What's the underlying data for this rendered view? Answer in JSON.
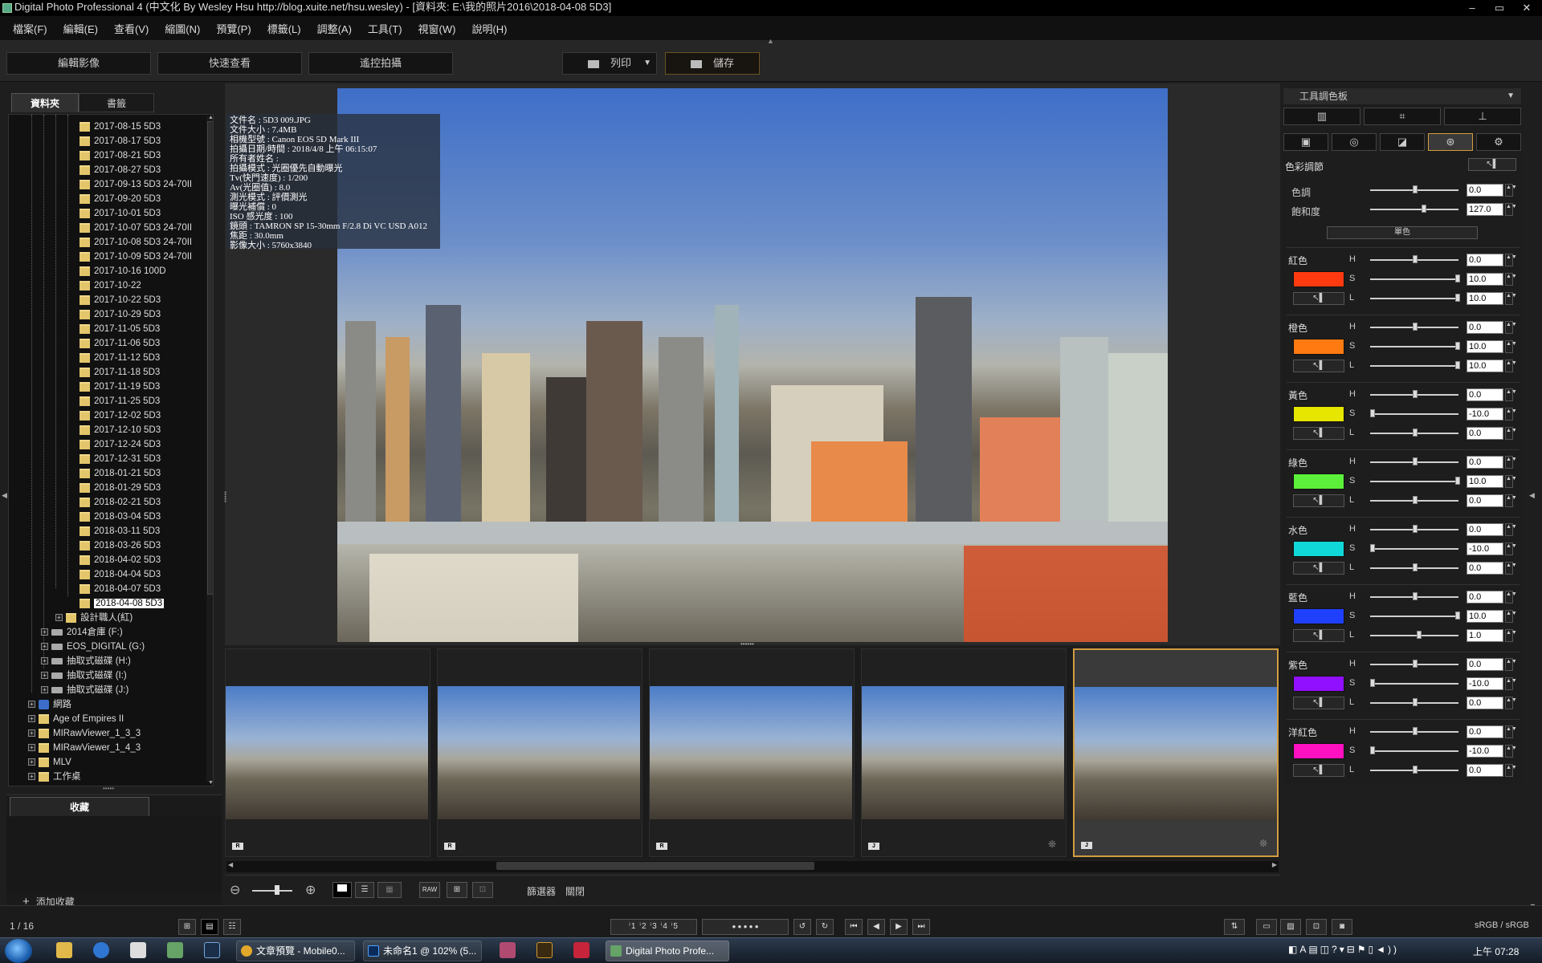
{
  "window": {
    "title": "Digital Photo Professional 4 (中文化 By Wesley Hsu http://blog.xuite.net/hsu.wesley) - [資料夾: E:\\我的照片2016\\2018-04-08 5D3]",
    "minimize": "–",
    "maximize": "▭",
    "close": "✕"
  },
  "menu": [
    "檔案(F)",
    "編輯(E)",
    "查看(V)",
    "縮圖(N)",
    "預覽(P)",
    "標籤(L)",
    "調整(A)",
    "工具(T)",
    "視窗(W)",
    "說明(H)"
  ],
  "toolbar": {
    "edit_image": "編輯影像",
    "quick_check": "快速查看",
    "remote_shoot": "遙控拍攝",
    "print": "列印",
    "save": "儲存"
  },
  "left_panel": {
    "tabs": [
      "資料夾",
      "書籤"
    ],
    "tree": [
      "2017-08-15 5D3",
      "2017-08-17 5D3",
      "2017-08-21 5D3",
      "2017-08-27 5D3",
      "2017-09-13 5D3 24-70II",
      "2017-09-20 5D3",
      "2017-10-01 5D3",
      "2017-10-07 5D3 24-70II",
      "2017-10-08 5D3 24-70II",
      "2017-10-09 5D3 24-70II",
      "2017-10-16 100D",
      "2017-10-22",
      "2017-10-22 5D3",
      "2017-10-29 5D3",
      "2017-11-05 5D3",
      "2017-11-06 5D3",
      "2017-11-12 5D3",
      "2017-11-18 5D3",
      "2017-11-19 5D3",
      "2017-11-25 5D3",
      "2017-12-02 5D3",
      "2017-12-10 5D3",
      "2017-12-24 5D3",
      "2017-12-31 5D3",
      "2018-01-21 5D3",
      "2018-01-29 5D3",
      "2018-02-21 5D3",
      "2018-03-04 5D3",
      "2018-03-11 5D3",
      "2018-03-26 5D3",
      "2018-04-02 5D3",
      "2018-04-04 5D3",
      "2018-04-07 5D3",
      "2018-04-08 5D3"
    ],
    "tree_other": [
      {
        "label": "設計職人(紅)",
        "type": "folder",
        "indent": 2
      },
      {
        "label": "2014倉庫 (F:)",
        "type": "drive",
        "indent": 1
      },
      {
        "label": "EOS_DIGITAL (G:)",
        "type": "drive",
        "indent": 1
      },
      {
        "label": "抽取式磁碟 (H:)",
        "type": "drive",
        "indent": 1
      },
      {
        "label": "抽取式磁碟 (I:)",
        "type": "drive",
        "indent": 1
      },
      {
        "label": "抽取式磁碟 (J:)",
        "type": "drive",
        "indent": 1
      },
      {
        "label": "網路",
        "type": "network",
        "indent": 0
      },
      {
        "label": "Age of Empires II",
        "type": "folder",
        "indent": 0
      },
      {
        "label": "MIRawViewer_1_3_3",
        "type": "folder",
        "indent": 0
      },
      {
        "label": "MIRawViewer_1_4_3",
        "type": "folder",
        "indent": 0
      },
      {
        "label": "MLV",
        "type": "folder",
        "indent": 0
      },
      {
        "label": "工作桌",
        "type": "folder",
        "indent": 0
      }
    ],
    "favorites_tab": "收藏",
    "add_favorite": "添加收藏"
  },
  "info": [
    "文件名 : 5D3 009.JPG",
    "文件大小 : 7.4MB",
    "相機型號 : Canon EOS 5D Mark III",
    "拍攝日期/時間 : 2018/4/8 上午 06:15:07",
    "所有者姓名 :",
    "拍攝模式 : 光圈優先自動曝光",
    "Tv(快門速度) : 1/200",
    "Av(光圈值) : 8.0",
    "測光模式 : 評價測光",
    "曝光補償 : 0",
    "ISO 感光度 : 100",
    "鏡頭 : TAMRON SP 15-30mm F/2.8 Di VC USD A012",
    "焦距 : 30.0mm",
    "影像大小 : 5760x3840"
  ],
  "thumbnails": [
    {
      "label": "R",
      "star": ""
    },
    {
      "label": "R",
      "star": ""
    },
    {
      "label": "R",
      "star": ""
    },
    {
      "label": "J",
      "star": "❊"
    },
    {
      "label": "J",
      "star": "❊"
    }
  ],
  "viewbar": {
    "filter": "篩選器",
    "close": "關閉",
    "raw_label": "RAW"
  },
  "right_panel": {
    "title": "工具調色板",
    "section_title": "色彩調節",
    "hue_label": "色調",
    "hue_value": "0.0",
    "sat_label": "飽和度",
    "sat_value": "127.0",
    "mono_button": "單色",
    "h": "H",
    "s": "S",
    "l": "L",
    "colors": [
      {
        "name": "紅色",
        "swatch": "#ff3a10",
        "h": "0.0",
        "s": "10.0",
        "l": "10.0",
        "hp": 0.5,
        "sp": 1.0,
        "lp": 1.0
      },
      {
        "name": "橙色",
        "swatch": "#ff7a10",
        "h": "0.0",
        "s": "10.0",
        "l": "10.0",
        "hp": 0.5,
        "sp": 1.0,
        "lp": 1.0
      },
      {
        "name": "黃色",
        "swatch": "#e6e600",
        "h": "0.0",
        "s": "-10.0",
        "l": "0.0",
        "hp": 0.5,
        "sp": 0.0,
        "lp": 0.5
      },
      {
        "name": "綠色",
        "swatch": "#5cf03a",
        "h": "0.0",
        "s": "10.0",
        "l": "0.0",
        "hp": 0.5,
        "sp": 1.0,
        "lp": 0.5
      },
      {
        "name": "水色",
        "swatch": "#10d8d8",
        "h": "0.0",
        "s": "-10.0",
        "l": "0.0",
        "hp": 0.5,
        "sp": 0.0,
        "lp": 0.5
      },
      {
        "name": "藍色",
        "swatch": "#2040ff",
        "h": "0.0",
        "s": "10.0",
        "l": "1.0",
        "hp": 0.5,
        "sp": 1.0,
        "lp": 0.55
      },
      {
        "name": "紫色",
        "swatch": "#9010ff",
        "h": "0.0",
        "s": "-10.0",
        "l": "0.0",
        "hp": 0.5,
        "sp": 0.0,
        "lp": 0.5
      },
      {
        "name": "洋紅色",
        "swatch": "#ff10c0",
        "h": "0.0",
        "s": "-10.0",
        "l": "0.0",
        "hp": 0.5,
        "sp": 0.0,
        "lp": 0.5
      }
    ],
    "hue_pos": 0.5,
    "sat_pos": 0.6
  },
  "status": {
    "count": "1 / 16",
    "colorspace": "sRGB / sRGB",
    "ratings": "ⁱ1 ⁱ2 ⁱ3 ⁱ4 ⁱ5",
    "dots": "● ● ● ● ●"
  },
  "taskbar": {
    "items": [
      "文章預覽 - Mobile0...",
      "未命名1 @ 102% (5...",
      "Digital Photo Profe..."
    ],
    "clock": "上午 07:28"
  }
}
